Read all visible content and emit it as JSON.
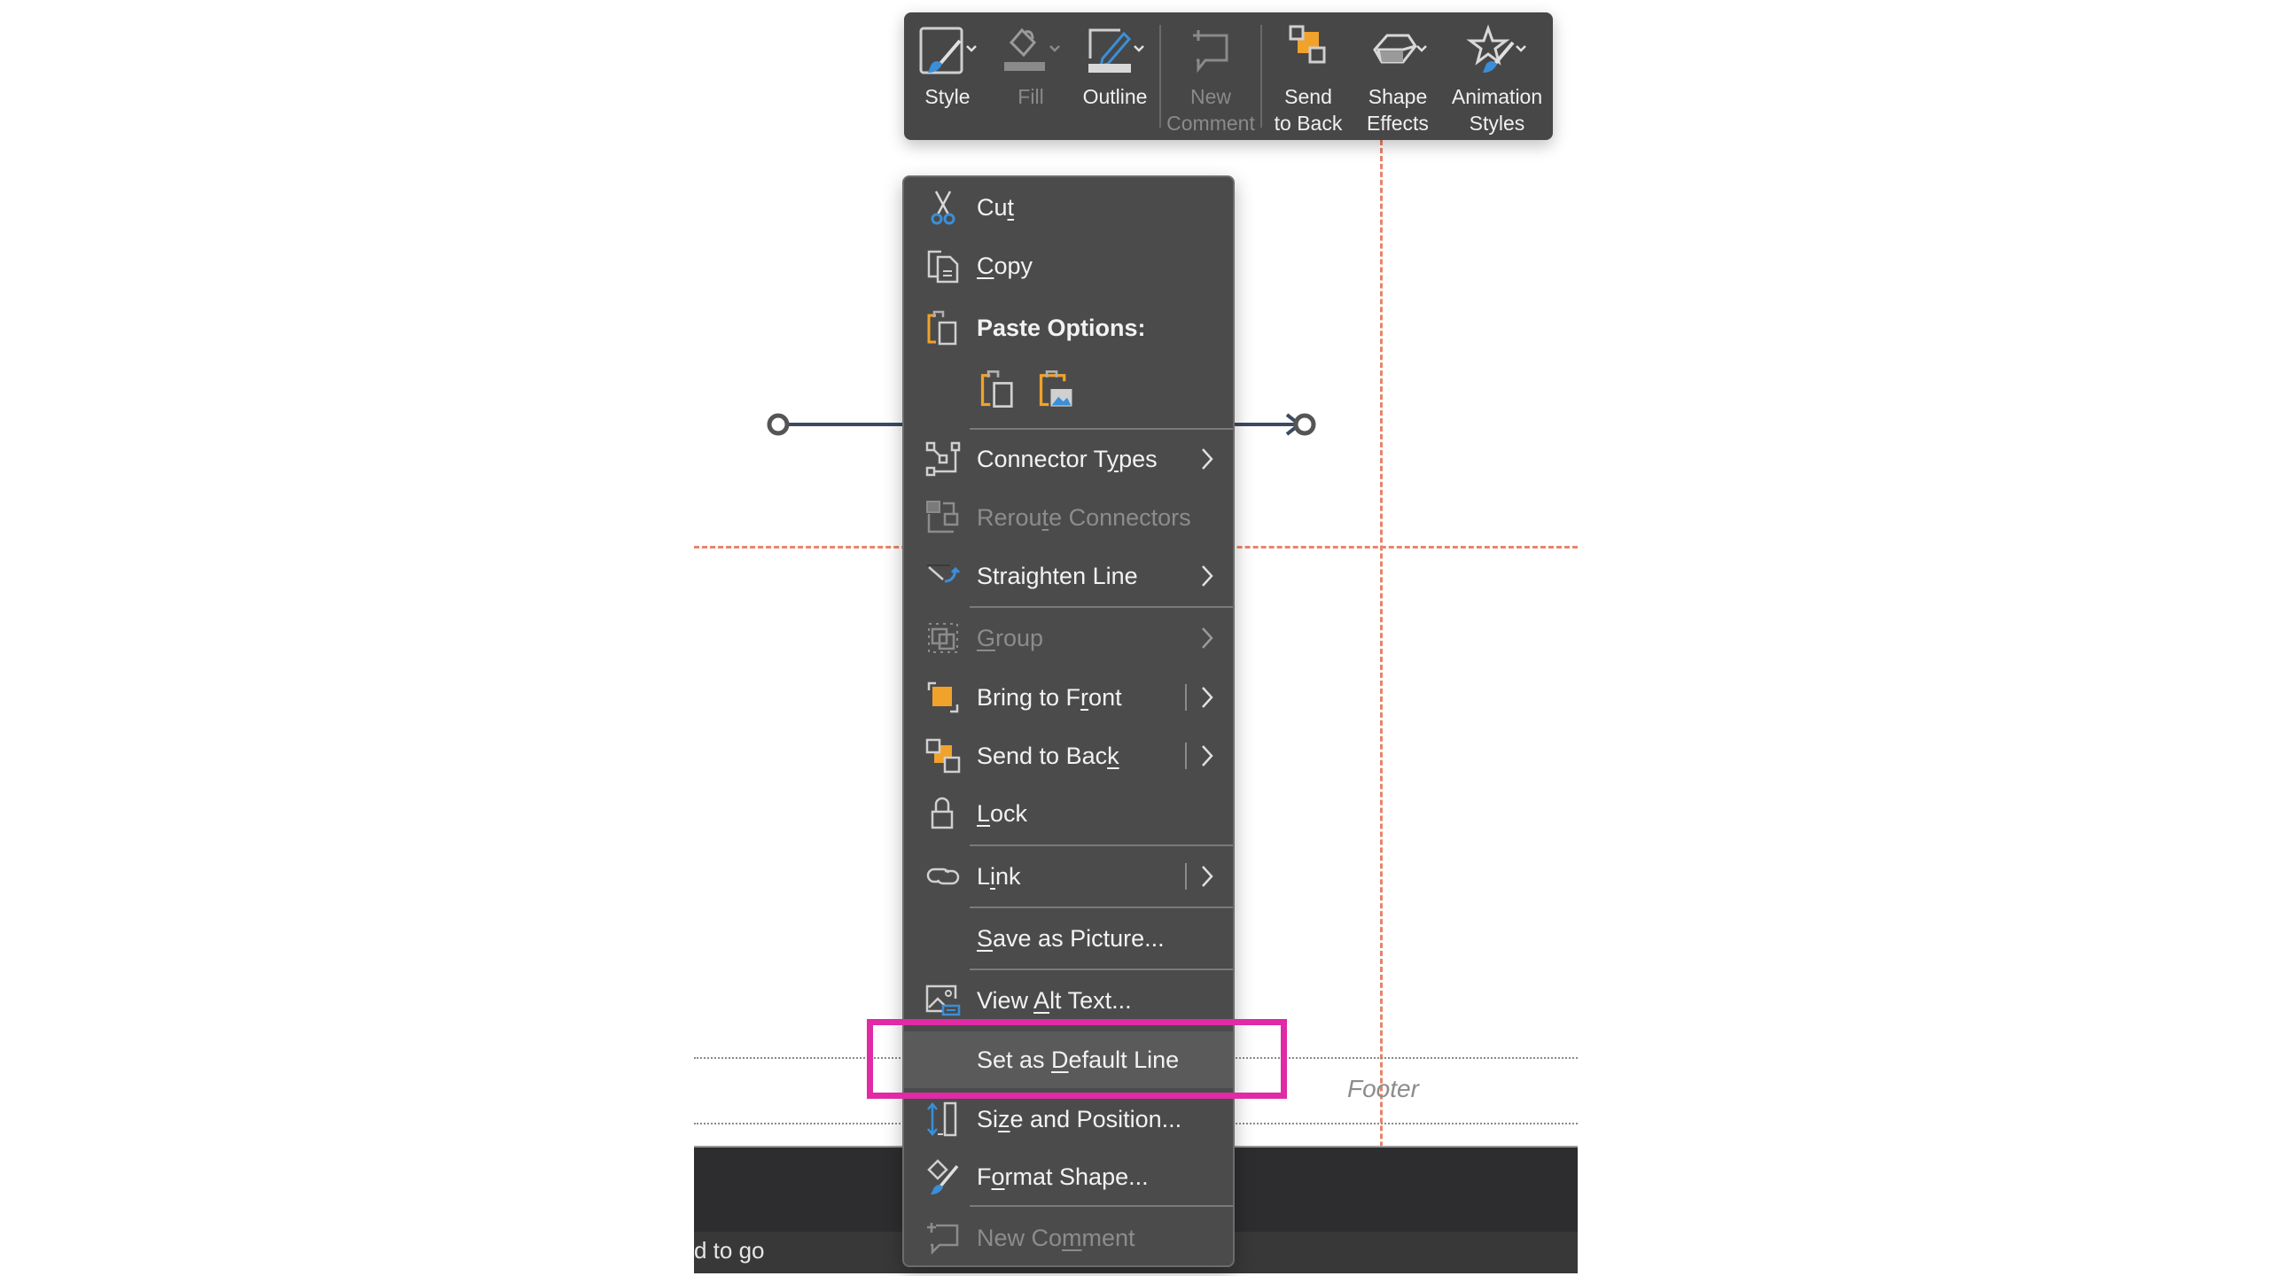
{
  "toolbar": {
    "buttons": [
      {
        "id": "style",
        "label": "Style",
        "icon": "style-brush-icon",
        "dropdown": true,
        "enabled": true
      },
      {
        "id": "fill",
        "label": "Fill",
        "icon": "fill-bucket-icon",
        "dropdown": true,
        "enabled": false
      },
      {
        "id": "outline",
        "label": "Outline",
        "icon": "outline-pen-icon",
        "dropdown": true,
        "enabled": true
      },
      {
        "id": "new-comment",
        "label": "New\nComment",
        "icon": "new-comment-icon",
        "dropdown": false,
        "enabled": false
      },
      {
        "id": "send-to-back",
        "label": "Send\nto Back",
        "icon": "send-to-back-icon",
        "dropdown": false,
        "enabled": true
      },
      {
        "id": "shape-effects",
        "label": "Shape\nEffects",
        "icon": "shape-effects-icon",
        "dropdown": true,
        "enabled": true
      },
      {
        "id": "animation-styles",
        "label": "Animation\nStyles",
        "icon": "animation-styles-icon",
        "dropdown": true,
        "enabled": true
      }
    ]
  },
  "context_menu": {
    "items": [
      {
        "label_pre": "Cu",
        "label_u": "t",
        "label_post": "",
        "icon": "scissors-icon",
        "enabled": true
      },
      {
        "label_pre": "",
        "label_u": "C",
        "label_post": "opy",
        "icon": "copy-icon",
        "enabled": true
      },
      {
        "label": "Paste Options:",
        "icon": "paste-icon",
        "enabled": true,
        "bold": true
      },
      {
        "label_pre": "Connector T",
        "label_u": "y",
        "label_post": "pes",
        "icon": "connector-types-icon",
        "enabled": true,
        "submenu": true
      },
      {
        "label_pre": "Rerou",
        "label_u": "t",
        "label_post": "e Connectors",
        "icon": "reroute-connectors-icon",
        "enabled": false
      },
      {
        "label_pre": "Straighten Line",
        "label_u": "",
        "label_post": "",
        "icon": "straighten-line-icon",
        "enabled": true,
        "submenu": true
      },
      {
        "label_pre": "",
        "label_u": "G",
        "label_post": "roup",
        "icon": "group-icon",
        "enabled": false,
        "submenu": true
      },
      {
        "label_pre": "Bring to F",
        "label_u": "r",
        "label_post": "ont",
        "icon": "bring-to-front-icon",
        "enabled": true,
        "submenu": true,
        "split": true
      },
      {
        "label_pre": "Send to Bac",
        "label_u": "k",
        "label_post": "",
        "icon": "send-to-back-icon",
        "enabled": true,
        "submenu": true,
        "split": true
      },
      {
        "label_pre": "",
        "label_u": "L",
        "label_post": "ock",
        "icon": "lock-icon",
        "enabled": true
      },
      {
        "label_pre": "L",
        "label_u": "i",
        "label_post": "nk",
        "icon": "link-icon",
        "enabled": true,
        "submenu": true,
        "split": true
      },
      {
        "label_pre": "",
        "label_u": "S",
        "label_post": "ave as Picture...",
        "icon": "",
        "enabled": true
      },
      {
        "label_pre": "View ",
        "label_u": "A",
        "label_post": "lt Text...",
        "icon": "alt-text-icon",
        "enabled": true
      },
      {
        "label_pre": "Set as ",
        "label_u": "D",
        "label_post": "efault Line",
        "icon": "",
        "enabled": true,
        "highlighted": true
      },
      {
        "label_pre": "Si",
        "label_u": "z",
        "label_post": "e and Position...",
        "icon": "size-position-icon",
        "enabled": true
      },
      {
        "label_pre": "F",
        "label_u": "o",
        "label_post": "rmat Shape...",
        "icon": "format-shape-icon",
        "enabled": true
      },
      {
        "label_pre": "New Co",
        "label_u": "m",
        "label_post": "ment",
        "icon": "new-comment-icon",
        "enabled": false
      }
    ],
    "paste_option_icons": [
      "paste-use-destination-theme-icon",
      "paste-as-picture-icon"
    ]
  },
  "slide": {
    "footer_placeholder": "Footer",
    "status_text": "d to go"
  },
  "annotation": {
    "highlight_color": "#e02aa6",
    "highlighted_item": "Set as Default Line"
  },
  "colors": {
    "menu_bg": "#4b4b4b",
    "toolbar_bg": "#474747",
    "accent_blue": "#3a8fd8",
    "accent_orange": "#f0a22a",
    "guide_orange": "#e9846a"
  }
}
